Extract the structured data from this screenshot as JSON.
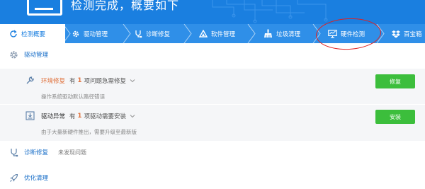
{
  "header": {
    "title": "检测完成，概要如下"
  },
  "tabs": [
    {
      "label": "检测概要",
      "icon": "refresh-icon",
      "active": true
    },
    {
      "label": "驱动管理",
      "icon": "gear-icon",
      "active": false
    },
    {
      "label": "诊断修复",
      "icon": "stethoscope-icon",
      "active": false
    },
    {
      "label": "软件管理",
      "icon": "triangle-apps-icon",
      "active": false
    },
    {
      "label": "垃圾清理",
      "icon": "broom-icon",
      "active": false
    },
    {
      "label": "硬件检测",
      "icon": "monitor-icon",
      "active": false
    },
    {
      "label": "百宝箱",
      "icon": "dropbox-icon",
      "active": false
    }
  ],
  "driver_section": {
    "label": "驱动管理",
    "icon": "gear-icon"
  },
  "env_issue": {
    "title": "环境修复",
    "prefix": "有",
    "count": "1",
    "suffix": "项问题急需修复",
    "description": "操作系统驱动默认路径错误",
    "button": "修复",
    "icon": "wrench-icon"
  },
  "driver_issue": {
    "title": "驱动异常",
    "prefix": "有",
    "count": "1",
    "suffix": "项驱动需要安装",
    "description": "由于大量新硬件推出，需要升级至最新版",
    "button": "安装",
    "icon": "driver-box-icon"
  },
  "diagnose_section": {
    "label": "诊断修复",
    "status": "未发现问题",
    "icon": "stethoscope-icon"
  },
  "optimize_section": {
    "label": "优化清理",
    "icon": "rocket-icon"
  },
  "colors": {
    "header_blue": "#1a7fe0",
    "tab_blue": "#2f8fe8",
    "accent_orange": "#e0703a",
    "button_green": "#3cbe3c",
    "highlight_red": "#e02020"
  }
}
